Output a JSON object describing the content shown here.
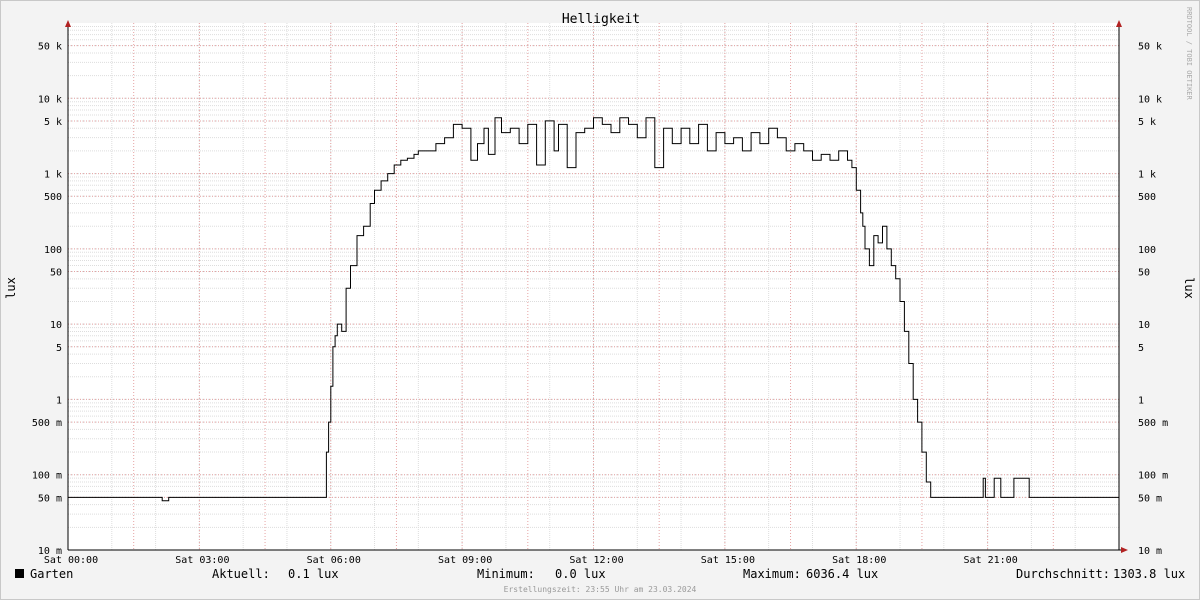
{
  "chart_data": {
    "type": "line",
    "title": "Helligkeit",
    "ylabel_left": "lux",
    "ylabel_right": "lux",
    "y_scale": "log",
    "ylim": [
      0.01,
      100000
    ],
    "xlim_hours": [
      0,
      24
    ],
    "y_ticks": [
      {
        "value": 0.01,
        "label": "10 m"
      },
      {
        "value": 0.05,
        "label": "50 m"
      },
      {
        "value": 0.1,
        "label": "100 m"
      },
      {
        "value": 0.5,
        "label": "500 m"
      },
      {
        "value": 1,
        "label": "1"
      },
      {
        "value": 5,
        "label": "5"
      },
      {
        "value": 10,
        "label": "10"
      },
      {
        "value": 50,
        "label": "50"
      },
      {
        "value": 100,
        "label": "100"
      },
      {
        "value": 500,
        "label": "500"
      },
      {
        "value": 1000,
        "label": "1 k"
      },
      {
        "value": 5000,
        "label": "5 k"
      },
      {
        "value": 10000,
        "label": "10 k"
      },
      {
        "value": 50000,
        "label": "50 k"
      }
    ],
    "x_ticks": [
      {
        "hour": 0,
        "label": "Sat 00:00"
      },
      {
        "hour": 3,
        "label": "Sat 03:00"
      },
      {
        "hour": 6,
        "label": "Sat 06:00"
      },
      {
        "hour": 9,
        "label": "Sat 09:00"
      },
      {
        "hour": 12,
        "label": "Sat 12:00"
      },
      {
        "hour": 15,
        "label": "Sat 15:00"
      },
      {
        "hour": 18,
        "label": "Sat 18:00"
      },
      {
        "hour": 21,
        "label": "Sat 21:00"
      }
    ],
    "series": [
      {
        "name": "Garten",
        "color": "#000000",
        "x_hours": [
          0.0,
          2.1,
          2.15,
          2.3,
          5.85,
          5.9,
          5.95,
          6.0,
          6.05,
          6.1,
          6.15,
          6.25,
          6.35,
          6.45,
          6.6,
          6.75,
          6.9,
          7.0,
          7.15,
          7.3,
          7.45,
          7.6,
          7.75,
          7.9,
          8.0,
          8.2,
          8.4,
          8.6,
          8.8,
          9.0,
          9.2,
          9.35,
          9.5,
          9.6,
          9.75,
          9.9,
          10.1,
          10.3,
          10.5,
          10.7,
          10.9,
          11.1,
          11.2,
          11.4,
          11.6,
          11.8,
          12.0,
          12.2,
          12.4,
          12.6,
          12.8,
          13.0,
          13.2,
          13.4,
          13.6,
          13.8,
          14.0,
          14.2,
          14.4,
          14.6,
          14.8,
          15.0,
          15.2,
          15.4,
          15.6,
          15.8,
          16.0,
          16.2,
          16.4,
          16.6,
          16.8,
          17.0,
          17.2,
          17.4,
          17.6,
          17.8,
          17.9,
          18.0,
          18.1,
          18.15,
          18.2,
          18.3,
          18.4,
          18.5,
          18.6,
          18.7,
          18.8,
          18.9,
          19.0,
          19.1,
          19.2,
          19.3,
          19.4,
          19.5,
          19.6,
          19.7,
          19.8,
          19.9,
          20.0,
          20.2,
          20.4,
          20.6,
          20.9,
          20.95,
          21.1,
          21.15,
          21.3,
          21.35,
          21.55,
          21.6,
          21.9,
          21.95,
          24.0
        ],
        "y_lux": [
          0.05,
          0.05,
          0.045,
          0.05,
          0.05,
          0.2,
          0.5,
          1.5,
          5,
          7,
          10,
          8,
          30,
          60,
          150,
          200,
          400,
          600,
          800,
          1000,
          1300,
          1500,
          1600,
          1800,
          2000,
          2000,
          2500,
          3000,
          4500,
          4000,
          1500,
          2500,
          4000,
          1800,
          5500,
          3500,
          4000,
          2500,
          4500,
          1300,
          5000,
          2000,
          4500,
          1200,
          3500,
          4000,
          5500,
          4500,
          3500,
          5500,
          4500,
          3000,
          5500,
          1200,
          4000,
          2500,
          4000,
          2500,
          4500,
          2000,
          3500,
          2500,
          3000,
          2000,
          3500,
          2500,
          4000,
          3000,
          2000,
          2500,
          2000,
          1500,
          1800,
          1500,
          2000,
          1500,
          1200,
          600,
          300,
          200,
          100,
          60,
          150,
          120,
          200,
          100,
          60,
          40,
          20,
          8,
          3,
          1,
          0.5,
          0.2,
          0.08,
          0.05,
          0.05,
          0.05,
          0.05,
          0.05,
          0.05,
          0.05,
          0.09,
          0.05,
          0.05,
          0.09,
          0.05,
          0.05,
          0.05,
          0.09,
          0.09,
          0.05,
          0.05,
          0.05
        ]
      }
    ],
    "grid": true
  },
  "legend": {
    "series_name": "Garten",
    "current_label": "Aktuell:",
    "current_value": "0.1 lux",
    "min_label": "Minimum:",
    "min_value": "0.0 lux",
    "max_label": "Maximum:",
    "max_value": "6036.4 lux",
    "avg_label": "Durchschnitt:",
    "avg_value": "1303.8 lux"
  },
  "watermark": "RRDTOOL / TOBI OETIKER",
  "footer": "Erstellungszeit: 23:55 Uhr am 23.03.2024"
}
